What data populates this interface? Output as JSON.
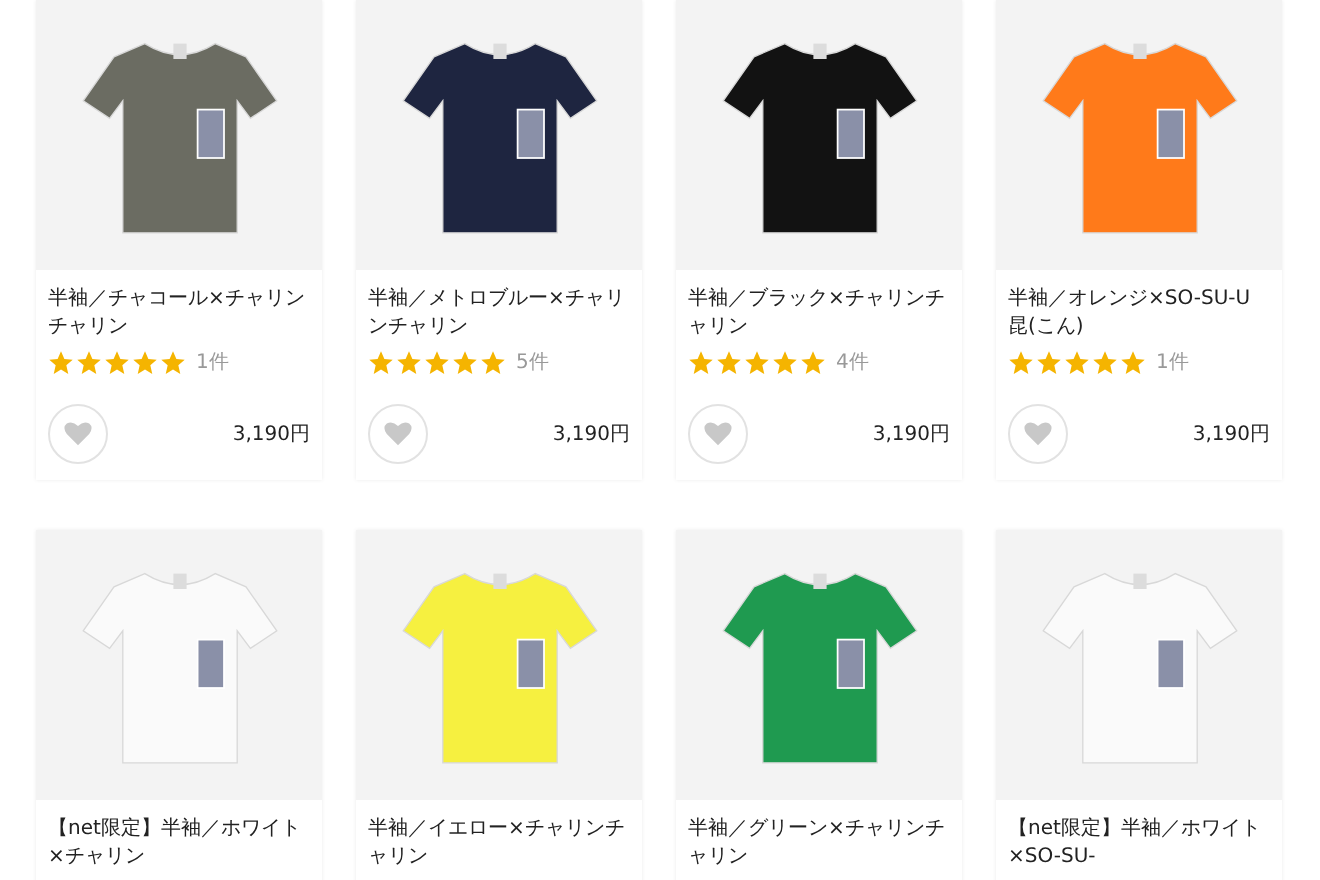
{
  "products": [
    {
      "title": "半袖／チャコール×チャリンチャリン",
      "color": "#6b6c62",
      "stars": 5,
      "review_count": "1件",
      "favorited": false,
      "price": "3,190円"
    },
    {
      "title": "半袖／メトロブルー×チャリンチャリン",
      "color": "#1e2540",
      "stars": 5,
      "review_count": "5件",
      "favorited": false,
      "price": "3,190円"
    },
    {
      "title": "半袖／ブラック×チャリンチャリン",
      "color": "#121212",
      "stars": 5,
      "review_count": "4件",
      "favorited": false,
      "price": "3,190円"
    },
    {
      "title": "半袖／オレンジ×SO-SU-U昆(こん)",
      "color": "#ff7a1a",
      "stars": 5,
      "review_count": "1件",
      "favorited": false,
      "price": "3,190円"
    },
    {
      "title": "【net限定】半袖／ホワイト×チャリン",
      "color": "#fafafa"
    },
    {
      "title": "半袖／イエロー×チャリンチャリン",
      "color": "#f6f040"
    },
    {
      "title": "半袖／グリーン×チャリンチャリン",
      "color": "#1f9a50"
    },
    {
      "title": "【net限定】半袖／ホワイト×SO-SU-",
      "color": "#fafafa"
    }
  ]
}
